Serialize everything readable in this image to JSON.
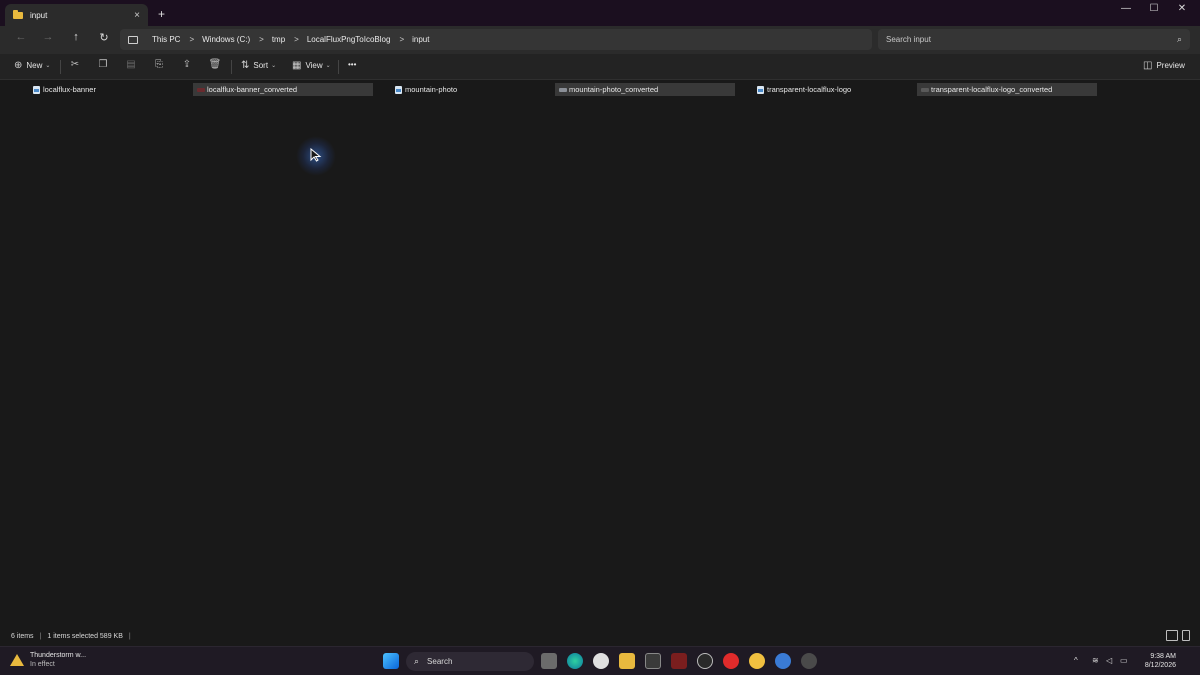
{
  "window": {
    "tab_title": "input",
    "tab_close": "×",
    "new_tab": "+",
    "minimize": "—",
    "maximize": "☐",
    "close": "✕"
  },
  "nav": {
    "back": "←",
    "forward": "→",
    "up": "↑",
    "refresh": "↻"
  },
  "breadcrumb": [
    "This PC",
    "Windows (C:)",
    "tmp",
    "LocalFluxPngToIcoBlog",
    "input"
  ],
  "breadcrumb_separator": ">",
  "search": {
    "placeholder": "Search input",
    "icon": "⌕"
  },
  "toolbar": {
    "new_label": "New",
    "sort_label": "Sort",
    "view_label": "View",
    "more_label": "•••",
    "preview_label": "Preview",
    "chevron": "⌄"
  },
  "files": [
    {
      "name": "localflux-banner",
      "selected": false,
      "kind": "png"
    },
    {
      "name": "localflux-banner_converted",
      "selected": true,
      "kind": "ico",
      "thumb_color": "#6a2a2e"
    },
    {
      "name": "mountain-photo",
      "selected": false,
      "kind": "png"
    },
    {
      "name": "mountain-photo_converted",
      "selected": true,
      "kind": "ico",
      "thumb_color": "#8a8f97"
    },
    {
      "name": "transparent-localflux-logo",
      "selected": false,
      "kind": "png"
    },
    {
      "name": "transparent-localflux-logo_converted",
      "selected": true,
      "kind": "ico",
      "thumb_color": "#5a5a5a"
    }
  ],
  "status": {
    "item_count": "6 items",
    "selected_info": "1 items selected  589 KB"
  },
  "taskbar": {
    "weather_title": "Thunderstorm w...",
    "weather_sub": "In effect",
    "search_placeholder": "Search",
    "time": "9:38 AM",
    "date": "8/12/2026",
    "tray_chevron": "^"
  },
  "colors": {
    "titlebar": "#1b0f1f",
    "accent_folder": "#e8b93e",
    "selected_bg": "#393939",
    "cursor_glow": "#3c78dc"
  }
}
